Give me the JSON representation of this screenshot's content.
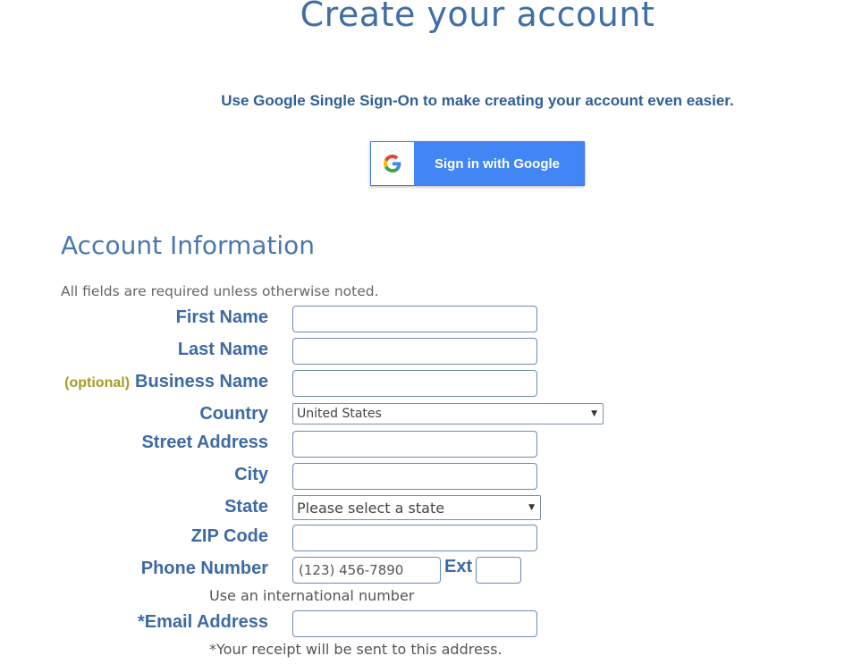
{
  "header": {
    "title": "Create your account",
    "sso_text": "Use Google Single Sign-On to make creating your account even easier."
  },
  "google_button": {
    "label": "Sign in with Google",
    "icon": "google-g-icon",
    "colors": {
      "background": "#4285f4",
      "g_blue": "#4285f4",
      "g_red": "#ea4335",
      "g_yellow": "#fbbc05",
      "g_green": "#34a853"
    }
  },
  "section": {
    "title": "Account Information",
    "note": "All fields are required unless otherwise noted."
  },
  "fields": {
    "first_name": {
      "label": "First Name",
      "value": ""
    },
    "last_name": {
      "label": "Last Name",
      "value": ""
    },
    "business_name": {
      "optional_tag": "(optional)",
      "label": "Business Name",
      "value": ""
    },
    "country": {
      "label": "Country",
      "selected": "United States"
    },
    "street_address": {
      "label": "Street Address",
      "value": ""
    },
    "city": {
      "label": "City",
      "value": ""
    },
    "state": {
      "label": "State",
      "selected": "Please select a state"
    },
    "zip": {
      "label": "ZIP Code",
      "value": ""
    },
    "phone": {
      "label": "Phone Number",
      "placeholder": "(123) 456-7890",
      "ext_label": "Ext",
      "helper": "Use an international number"
    },
    "email": {
      "label": "*Email Address",
      "value": "",
      "helper": "*Your receipt will be sent to this address."
    }
  },
  "colors": {
    "heading": "#3f6fa6",
    "label": "#3d6aa3",
    "optional": "#a59c27"
  }
}
